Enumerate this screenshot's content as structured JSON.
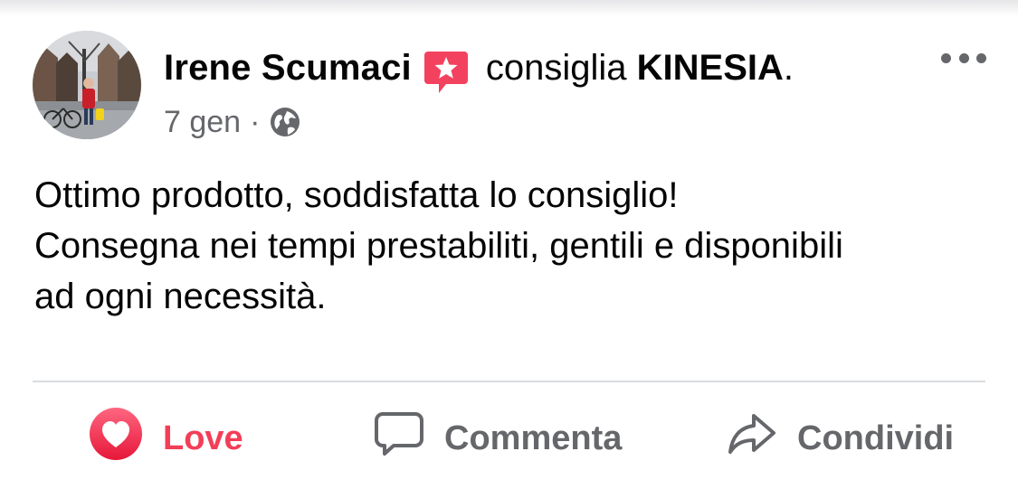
{
  "post": {
    "author": "Irene Scumaci",
    "recommend_text": "consiglia",
    "page_name": "KINESIA",
    "page_suffix": ".",
    "date": "7 gen",
    "separator": "·",
    "privacy_icon": "globe-icon",
    "body_lines": [
      "Ottimo prodotto, soddisfatta lo consiglio!",
      "Consegna nei tempi prestabiliti, gentili e disponibili",
      "ad ogni necessità."
    ]
  },
  "actions": {
    "love_label": "Love",
    "comment_label": "Commenta",
    "share_label": "Condividi"
  },
  "colors": {
    "love": "#f33e58",
    "badge": "#f3425f",
    "secondary_text": "#65676b",
    "primary_text": "#050505"
  }
}
